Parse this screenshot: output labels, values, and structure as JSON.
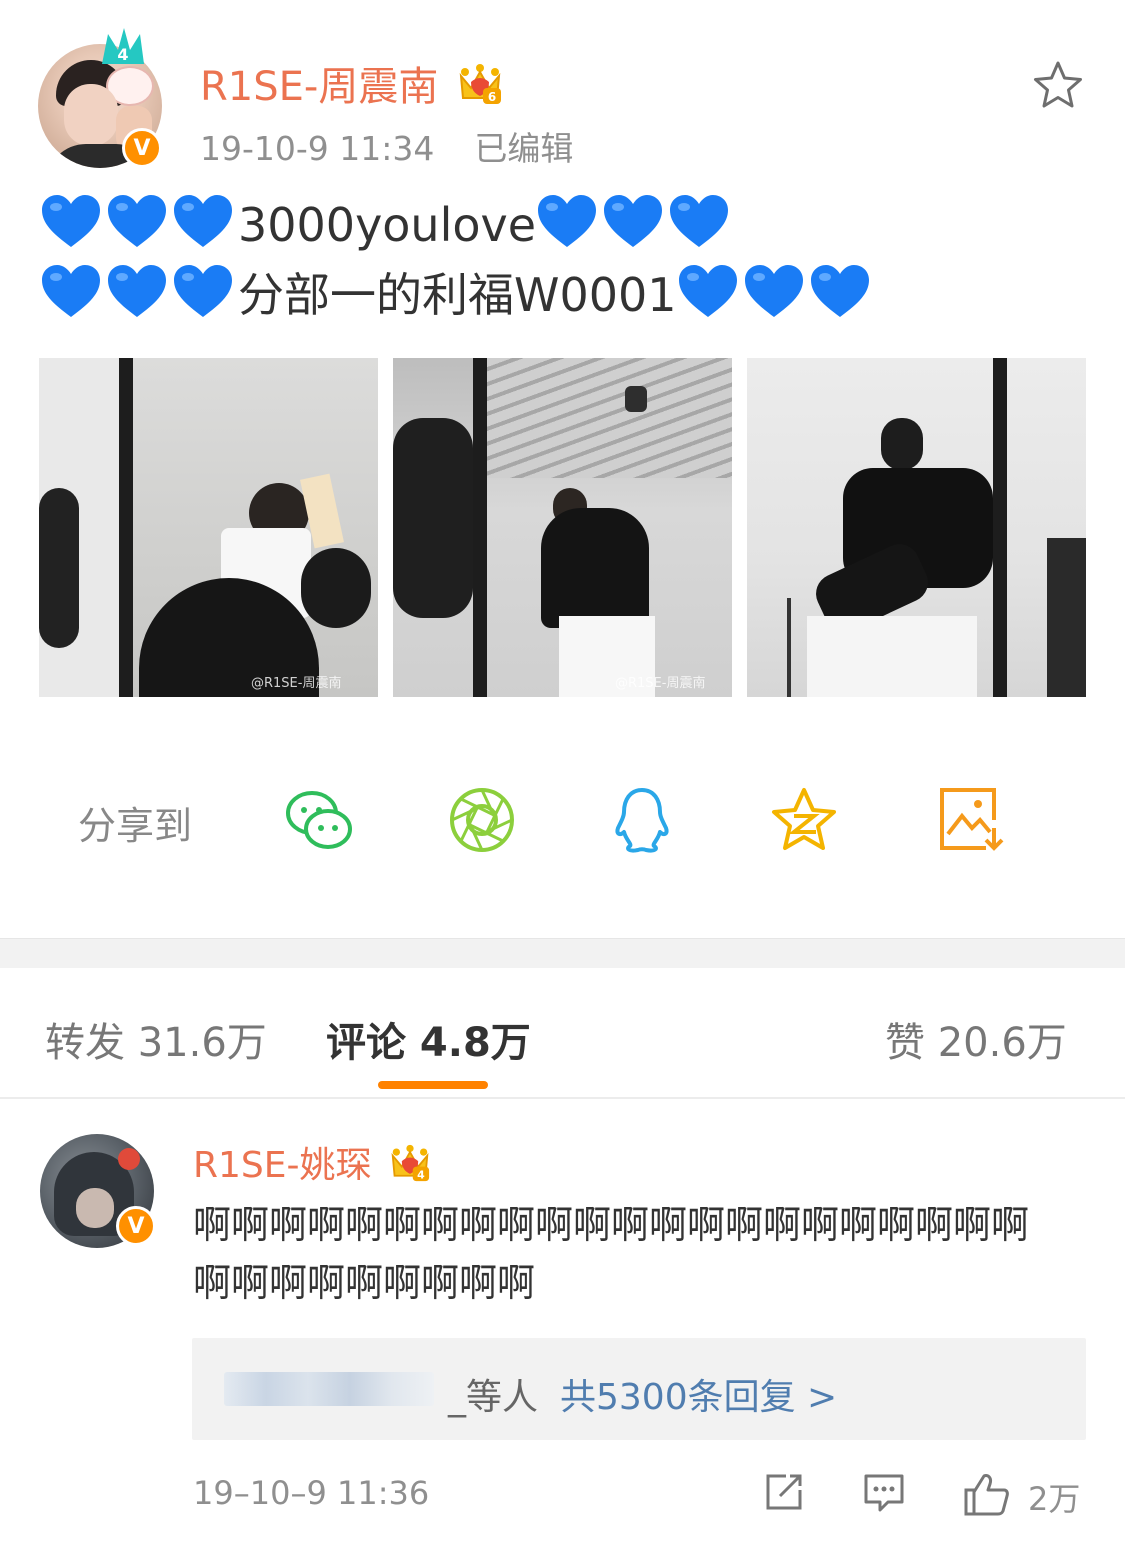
{
  "post": {
    "username": "R1SE-周震南",
    "level_badge": "6",
    "verified_badge": "V",
    "timestamp": "19-10-9 11:34",
    "edited": "已编辑",
    "line1_text": "3000youlove",
    "line2_text": "分部一的利福W0001",
    "emoji": "blue-heart",
    "photo_watermarks": [
      "@R1SE-周震南",
      "@R1SE-周震南",
      ""
    ]
  },
  "share": {
    "label": "分享到",
    "targets": [
      "wechat-icon",
      "moments-icon",
      "qq-icon",
      "qzone-icon",
      "save-image-icon"
    ]
  },
  "tabs": {
    "repost": "转发 31.6万",
    "comments": "评论 4.8万",
    "likes": "赞 20.6万"
  },
  "comment": {
    "username": "R1SE-姚琛",
    "level_badge": "4",
    "verified_badge": "V",
    "text": "啊啊啊啊啊啊啊啊啊啊啊啊啊啊啊啊啊啊啊啊啊啊啊啊啊啊啊啊啊啊啊",
    "reply_others": "_等人",
    "reply_count": "共5300条回复 >",
    "timestamp": "19–10–9 11:36",
    "like_count": "2万"
  },
  "colors": {
    "accent_orange": "#ff8200",
    "username_orange": "#eb7350",
    "link_blue": "#507daf",
    "heart_blue": "#1a7cf5"
  }
}
